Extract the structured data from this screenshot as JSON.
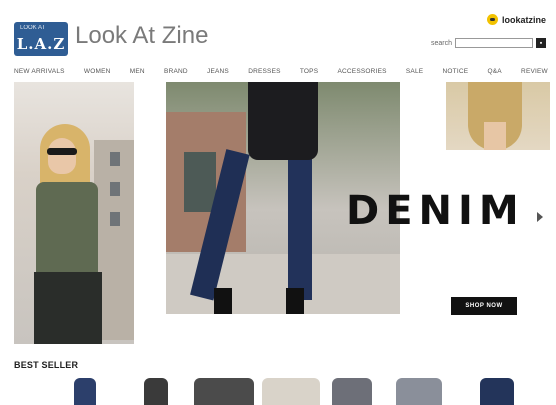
{
  "header": {
    "logo_badge": "L.A.Z",
    "logo_badge_small": "LOOK AT",
    "logo_text": "Look At Zine",
    "account_label": "lookatzine",
    "search_label": "search",
    "search_value": "",
    "search_button_icon": "search-go-icon"
  },
  "nav": {
    "items": [
      "NEW ARRIVALS",
      "WOMEN",
      "MEN",
      "BRAND",
      "JEANS",
      "DRESSES",
      "TOPS",
      "ACCESSORIES",
      "SALE",
      "NOTICE",
      "Q&A",
      "REVIEW"
    ]
  },
  "banner": {
    "headline": "DENIM",
    "cta_label": "SHOP NOW",
    "arrow_icon": "arrow-right-icon"
  },
  "bestseller": {
    "title": "BEST SELLER",
    "product_colors": [
      "#2c3f6b",
      "#3a3a3a",
      "#4b4b4b",
      "#d9d3c9",
      "#6d6f78",
      "#8a8f9a",
      "#23345a"
    ]
  }
}
